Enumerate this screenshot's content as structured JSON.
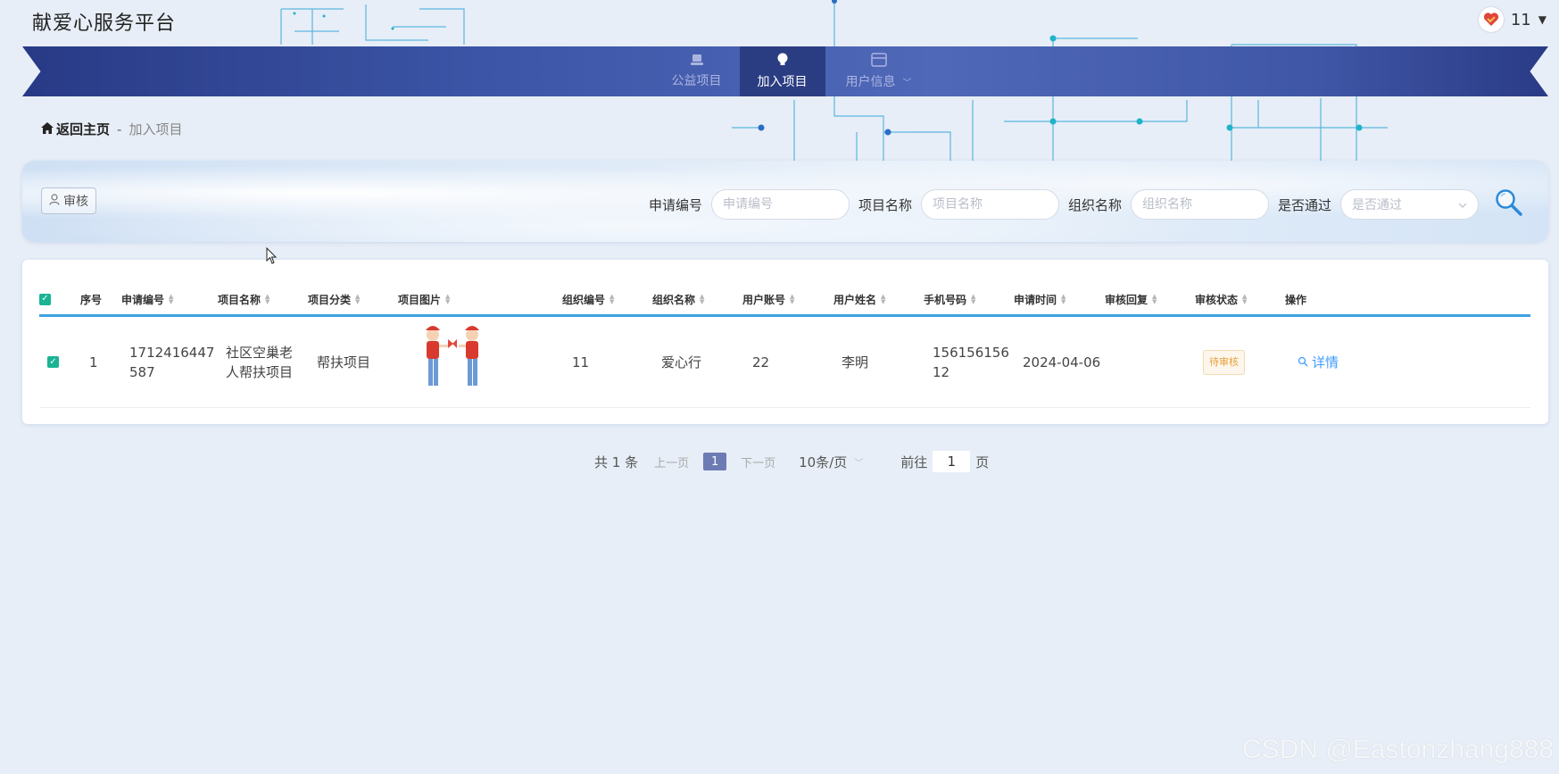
{
  "header": {
    "site_title": "献爱心服务平台",
    "username": "11"
  },
  "nav": {
    "items": [
      {
        "label": "公益项目",
        "icon": "laptop-icon"
      },
      {
        "label": "加入项目",
        "icon": "lightbulb-icon"
      },
      {
        "label": "用户信息",
        "icon": "card-icon"
      }
    ]
  },
  "breadcrumb": {
    "home": "返回主页",
    "separator": "-",
    "current": "加入项目"
  },
  "toolbar": {
    "audit_label": "审核"
  },
  "search": {
    "fields": [
      {
        "label": "申请编号",
        "placeholder": "申请编号"
      },
      {
        "label": "项目名称",
        "placeholder": "项目名称"
      },
      {
        "label": "组织名称",
        "placeholder": "组织名称"
      },
      {
        "label": "是否通过",
        "placeholder": "是否通过"
      }
    ]
  },
  "table": {
    "columns": [
      "序号",
      "申请编号",
      "项目名称",
      "项目分类",
      "项目图片",
      "组织编号",
      "组织名称",
      "用户账号",
      "用户姓名",
      "手机号码",
      "申请时间",
      "审核回复",
      "审核状态",
      "操作"
    ],
    "rows": [
      {
        "index": "1",
        "application_no": "1712416447587",
        "application_no_l1": "1712416447",
        "application_no_l2": "587",
        "project_name_l1": "社区空巢老",
        "project_name_l2": "人帮扶项目",
        "category": "帮扶项目",
        "org_no": "11",
        "org_name": "爱心行",
        "user_account": "22",
        "user_name": "李明",
        "phone_l1": "156156156",
        "phone_l2": "12",
        "apply_time": "2024-04-06",
        "reply": "",
        "status": "待审核",
        "action": "详情"
      }
    ]
  },
  "pagination": {
    "total": "共 1 条",
    "prev": "上一页",
    "current": "1",
    "next": "下一页",
    "page_size": "10条/页",
    "goto_label": "前往",
    "goto_value": "1",
    "page_suffix": "页"
  },
  "watermark": "CSDN @Eastonzhang888",
  "colors": {
    "accent": "#3ea2e2",
    "nav_active": "#2b3d82",
    "checkbox": "#1ab394",
    "status_pending": "#e6a23c",
    "link": "#409eff"
  }
}
